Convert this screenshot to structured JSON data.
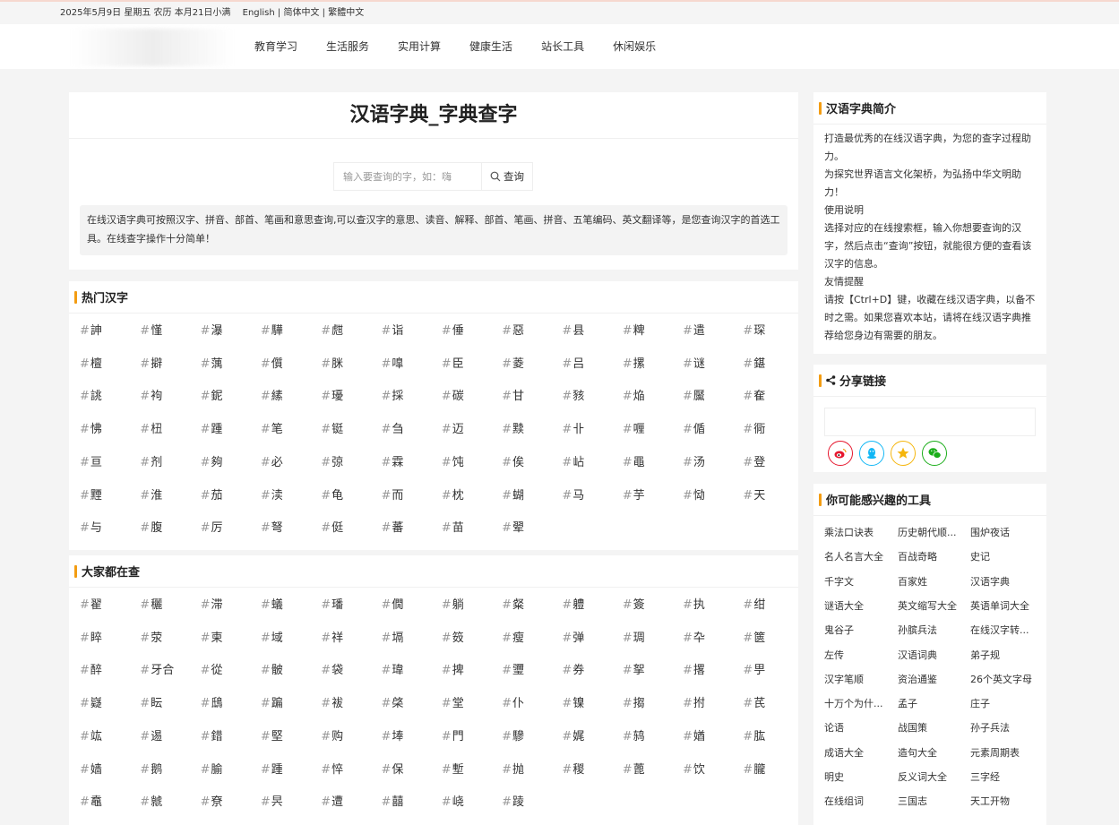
{
  "topbar": {
    "date": "2025年5月9日 星期五 农历 本月21日小满",
    "lang_en": "English",
    "lang_sep1": " | ",
    "lang_cn": "简体中文",
    "lang_sep2": " | ",
    "lang_tw": "繁體中文"
  },
  "nav": [
    "教育学习",
    "生活服务",
    "实用计算",
    "健康生活",
    "站长工具",
    "休闲娱乐"
  ],
  "main": {
    "title": "汉语字典_字典查字",
    "search_placeholder": "输入要查询的字，如：嗨",
    "search_button": "查询",
    "intro": "在线汉语字典可按照汉字、拼音、部首、笔画和意思查询,可以查汉字的意思、读音、解释、部首、笔画、拼音、五笔编码、英文翻译等，是您查询汉字的首选工具。在线查字操作十分简单！"
  },
  "hot": {
    "title": "热门汉字",
    "chars": [
      "訷",
      "慬",
      "瀑",
      "驊",
      "甝",
      "诣",
      "倕",
      "惡",
      "县",
      "粺",
      "遣",
      "琛",
      "檀",
      "擗",
      "蕅",
      "儨",
      "脒",
      "嘷",
      "臣",
      "菱",
      "吕",
      "摞",
      "谜",
      "鍖",
      "誂",
      "袧",
      "鈮",
      "縤",
      "瓇",
      "採",
      "碳",
      "甘",
      "豥",
      "焔",
      "黶",
      "奞",
      "怫",
      "杻",
      "踵",
      "笔",
      "铤",
      "刍",
      "迈",
      "黩",
      "卝",
      "喱",
      "偱",
      "衕",
      "亘",
      "剂",
      "夠",
      "必",
      "弶",
      "霖",
      "饨",
      "俟",
      "岾",
      "黽",
      "汤",
      "登",
      "黫",
      "淮",
      "茄",
      "渎",
      "龟",
      "而",
      "枕",
      "蝴",
      "马",
      "芋",
      "恸",
      "天",
      "与",
      "腹",
      "厉",
      "弩",
      "侹",
      "蕃",
      "苗",
      "翚"
    ]
  },
  "popular": {
    "title": "大家都在查",
    "chars": [
      "翟",
      "穲",
      "滞",
      "蟻",
      "璠",
      "僩",
      "躺",
      "粲",
      "軆",
      "簽",
      "执",
      "绀",
      "睟",
      "荥",
      "柬",
      "域",
      "祥",
      "塥",
      "笯",
      "瘦",
      "弹",
      "琱",
      "卆",
      "篋",
      "醉",
      "牙合",
      "從",
      "骳",
      "袋",
      "瑋",
      "捭",
      "瓕",
      "券",
      "挐",
      "撂",
      "甼",
      "嶷",
      "眃",
      "鴟",
      "蹁",
      "袚",
      "棨",
      "堂",
      "仆",
      "镍",
      "搊",
      "拊",
      "芪",
      "竑",
      "逷",
      "錯",
      "堅",
      "购",
      "埲",
      "門",
      "驂",
      "娓",
      "鸫",
      "媨",
      "肱",
      "嫱",
      "鹅",
      "腧",
      "踵",
      "悴",
      "保",
      "塹",
      "抛",
      "稯",
      "蓖",
      "饮",
      "朧",
      "鼁",
      "虩",
      "尞",
      "昗",
      "遭",
      "囍",
      "峣",
      "踜"
    ]
  },
  "sidebar": {
    "intro_title": "汉语字典简介",
    "intro_lines": [
      "打造最优秀的在线汉语字典，为您的查字过程助力。",
      "为探究世界语言文化架桥，为弘扬中华文明助力！",
      "使用说明",
      "选择对应的在线搜索框，输入你想要查询的汉字，然后点击“查询”按钮，就能很方便的查看该汉字的信息。",
      "友情提醒",
      "请按【Ctrl+D】键，收藏在线汉语字典，以备不时之需。如果您喜欢本站，请将在线汉语字典推荐给您身边有需要的朋友。"
    ],
    "share_title": "分享链接",
    "share_icons": [
      {
        "icon": "weibo-icon",
        "color": "#e6162d"
      },
      {
        "icon": "qq-icon",
        "color": "#12b7f5"
      },
      {
        "icon": "qzone-icon",
        "color": "#f5b60d"
      },
      {
        "icon": "wechat-icon",
        "color": "#1aad19"
      }
    ],
    "tools_title": "你可能感兴趣的工具",
    "tools": [
      "乘法口诀表",
      "历史朝代顺...",
      "围炉夜话",
      "名人名言大全",
      "百战奇略",
      "史记",
      "千字文",
      "百家姓",
      "汉语字典",
      "谜语大全",
      "英文缩写大全",
      "英语单词大全",
      "鬼谷子",
      "孙膑兵法",
      "在线汉字转...",
      "左传",
      "汉语词典",
      "弟子规",
      "汉字笔顺",
      "资治通鉴",
      "26个英文字母",
      "十万个为什...",
      "孟子",
      "庄子",
      "论语",
      "战国策",
      "孙子兵法",
      "成语大全",
      "造句大全",
      "元素周期表",
      "明史",
      "反义词大全",
      "三字经",
      "在线组词",
      "三国志",
      "天工开物"
    ]
  },
  "colors": {
    "accent": "#f39c12",
    "background": "#f4f4f4"
  }
}
